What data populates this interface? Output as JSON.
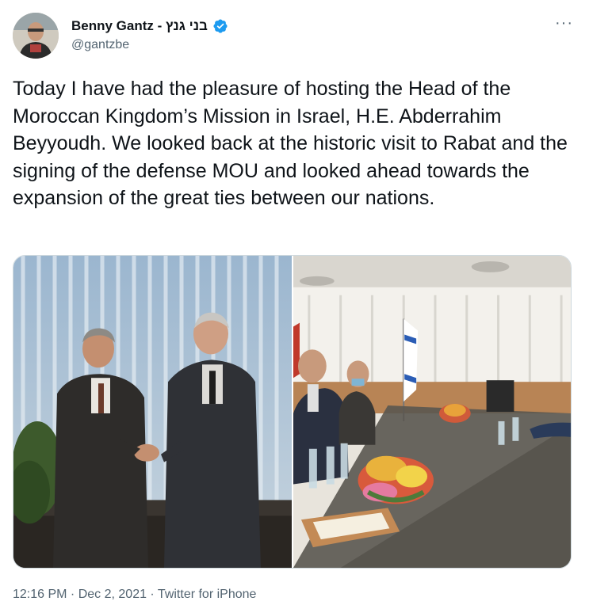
{
  "author": {
    "name": "Benny Gantz - בני גנץ",
    "handle": "@gantzbe",
    "verified": true,
    "accent_color": "#1d9bf0"
  },
  "menu": {
    "icon": "more-icon",
    "label": "···"
  },
  "tweet": {
    "text": "Today I have had the pleasure of hosting the Head of the Moroccan Kingdom’s Mission in Israel, H.E. Abderrahim Beyyoudh. We looked back at the historic visit to Rabat and the signing of the defense MOU and looked ahead towards the expansion of the great ties between our nations."
  },
  "media": {
    "count": 2,
    "items": [
      {
        "kind": "photo",
        "subject": "handshake"
      },
      {
        "kind": "photo",
        "subject": "meeting-table"
      }
    ]
  },
  "meta": {
    "time": "12:16 PM",
    "separator": " · ",
    "date": "Dec 2, 2021",
    "source": "Twitter for iPhone"
  }
}
